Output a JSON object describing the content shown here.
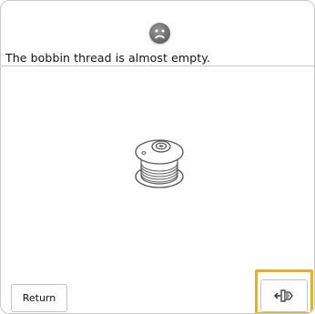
{
  "dialog": {
    "status_icon": "sad-face-icon",
    "message": "The bobbin thread is almost empty.",
    "illustration": "bobbin-icon"
  },
  "buttons": {
    "return_label": "Return",
    "bobbin_wind_icon": "bobbin-winding-icon",
    "highlight_color": "#e9b21a"
  }
}
